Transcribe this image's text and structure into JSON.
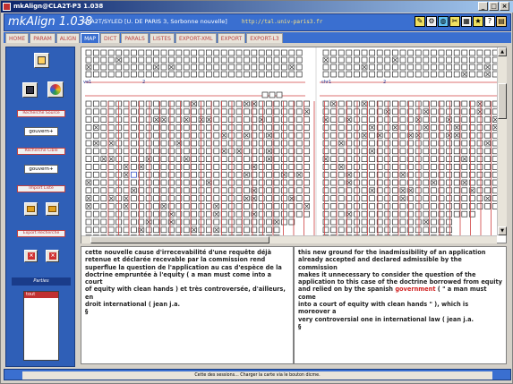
{
  "window": {
    "title": "mkAlign@CLA2T-P3 1.038",
    "controls": [
      "_",
      "□",
      "×"
    ]
  },
  "header": {
    "app_title": "mkAlign 1.038",
    "lab_info": "CLA2T/SYLED [U. DE PARIS 3, Sorbonne nouvelle]",
    "url": "http://tal.univ-paris3.fr",
    "icons": [
      "pencil-icon",
      "gears-icon",
      "globe-icon",
      "tools-icon",
      "grid-icon",
      "star-icon",
      "help-icon",
      "book-icon"
    ]
  },
  "tabs": [
    "HOME",
    "PARAM",
    "ALIGN",
    "MAP",
    "DICT",
    "PARALS",
    "LISTES",
    "EXPORT-XML",
    "EXPORT",
    "EXPORT-L3"
  ],
  "active_tab": "MAP",
  "left_panel": {
    "search_source_label": "Recherche Source",
    "source_value": "gouvern+",
    "search_target_label": "Recherche Cible",
    "target_value": "gouvern+",
    "import_label": "Import Liste",
    "export_label": "Export Recherche",
    "parties_label": "Parties",
    "parties_items": [
      "tout"
    ]
  },
  "matrix": {
    "left_label": "ve1",
    "left_num": "2",
    "right_label": "chr1",
    "right_num": "2",
    "colors": {
      "box_border": "#2a2a2a",
      "divider": "#d04040",
      "highlight": "#2040c0"
    }
  },
  "source_text": {
    "lines": [
      "cette nouvelle cause d'irrecevabilité d'une requête déjà",
      "retenue et déclarée recevable par la commission rend",
      "superflue la question de l'application au cas d'espèce de la",
      "doctrine empruntée à l'equity ( a man must come into a court",
      "of equity with clean hands ) et très controversée, d'ailleurs, en",
      "droit international ( jean j.a.",
      "§"
    ]
  },
  "target_text": {
    "lines": [
      "this new ground for the inadmissibility of an application",
      "already accepted and declared admissible by the commission",
      "makes it unnecessary to consider the question of the",
      "application to this case of the doctrine borrowed from equity",
      "and relied on by the spanish ",
      "government",
      " ( \" a man must come",
      "into a court of equity with clean hands \" ), which is moreover a",
      "very controversial one in international law ( jean j.a.",
      "§"
    ]
  },
  "status": {
    "text": "Cette des sessions... Charger la carte via le bouton dicme."
  }
}
